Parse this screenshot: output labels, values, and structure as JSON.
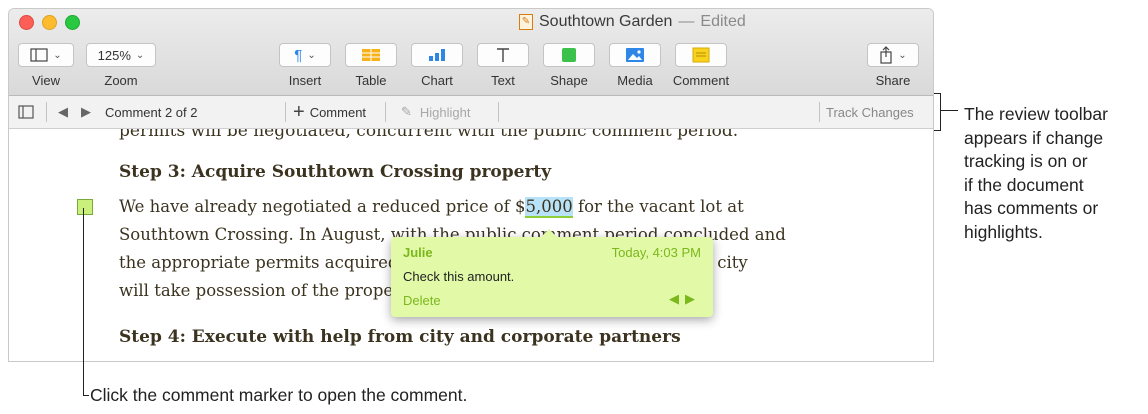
{
  "window": {
    "title": "Southtown Garden",
    "title_separator": "—",
    "title_status": "Edited"
  },
  "toolbar": {
    "view_label": "View",
    "zoom_value": "125%",
    "zoom_label": "Zoom",
    "insert_label": "Insert",
    "table_label": "Table",
    "chart_label": "Chart",
    "text_label": "Text",
    "shape_label": "Shape",
    "media_label": "Media",
    "comment_label": "Comment",
    "share_label": "Share"
  },
  "reviewbar": {
    "nav_text": "Comment 2 of 2",
    "add_comment_label": "Comment",
    "highlight_label": "Highlight",
    "track_changes_label": "Track Changes"
  },
  "document": {
    "cut_line": "permits will be negotiated, concurrent with the public comment period.",
    "heading3": "Step 3: Acquire Southtown Crossing property",
    "para_line1_before": "We have already negotiated a reduced price of $",
    "para_line1_highlight": "5,000",
    "para_line1_after": " for the vacant lot at",
    "para_line2": "Southtown Crossing. In August, with the public comment period concluded and",
    "para_line3": "the appropriate permits acquired, the city will finalize the sale and the city",
    "para_line4": "will take possession of the property.",
    "heading4": "Step 4: Execute with help from city and corporate partners"
  },
  "comment": {
    "author": "Julie",
    "time": "Today, 4:03 PM",
    "message": "Check this amount.",
    "delete_label": "Delete"
  },
  "callouts": {
    "right": [
      "The review toolbar",
      "appears if change",
      "tracking is on or",
      "if the document",
      "has comments or",
      "highlights."
    ],
    "bottom": "Click the comment marker to open the comment."
  },
  "colors": {
    "comment_green": "#7bb81c",
    "comment_bg": "#e2f9a8",
    "highlight_blue": "#b8e2f7"
  }
}
